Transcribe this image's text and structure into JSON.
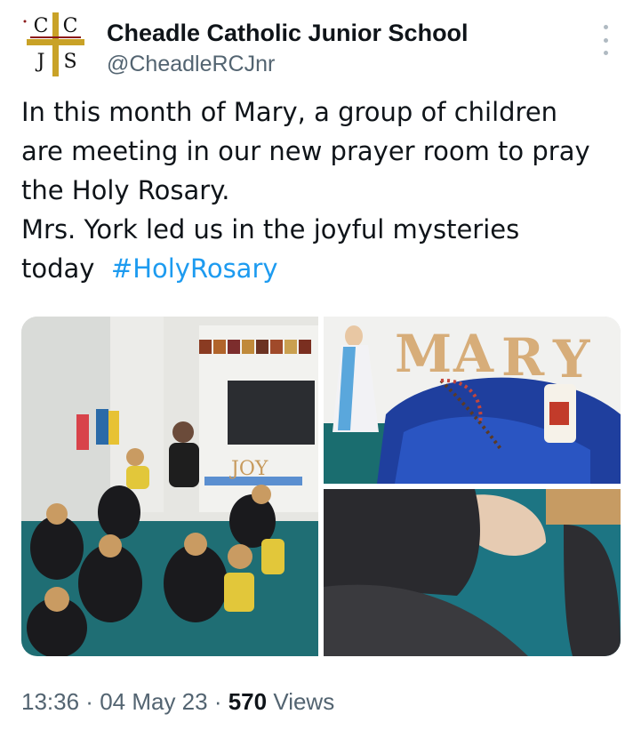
{
  "account": {
    "display_name": "Cheadle Catholic Junior School",
    "handle": "@CheadleRCJnr",
    "logo_letters": [
      "C",
      "C",
      "J",
      "S"
    ]
  },
  "tweet": {
    "lines": [
      "In this month of Mary, a group of children",
      "are meeting in our new prayer room to pray",
      "the Holy Rosary.",
      "Mrs. York led us in the joyful mysteries"
    ],
    "last_line_text": "today",
    "hashtag": "#HolyRosary"
  },
  "media": {
    "photo1_alt": "Children sitting in a circle in the prayer room",
    "photo2_alt": "Statue of Mary with MARY letters, rosary and candle",
    "photo3_alt": "Child's sleeve on teal carpet",
    "photo1_display_letters": "JOY",
    "photo2_letters": [
      "M",
      "A",
      "R",
      "Y"
    ]
  },
  "meta": {
    "time": "13:36",
    "separator": " · ",
    "date": "04 May 23",
    "views_count": "570",
    "views_label": "Views"
  },
  "icons": {
    "more": "more-options-icon"
  },
  "colors": {
    "hashtag": "#1d9bf0",
    "secondary_text": "#536471",
    "logo_gold": "#c9a227"
  }
}
